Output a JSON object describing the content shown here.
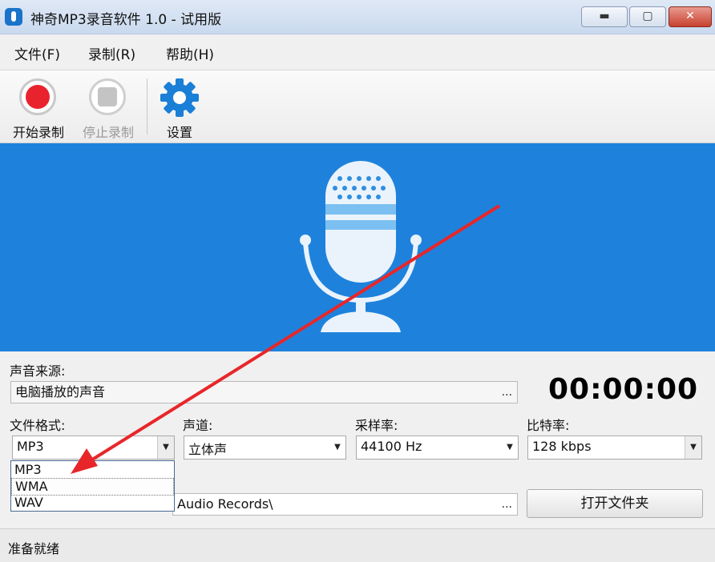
{
  "window": {
    "title": "神奇MP3录音软件 1.0 - 试用版"
  },
  "menu": {
    "items": [
      "文件(F)",
      "录制(R)",
      "帮助(H)"
    ]
  },
  "toolbar": {
    "start_label": "开始录制",
    "stop_label": "停止录制",
    "settings_label": "设置"
  },
  "source": {
    "label": "声音来源:",
    "value": "电脑播放的声音",
    "browse": "..."
  },
  "timer": "00:00:00",
  "format": {
    "label": "文件格式:",
    "value": "MP3",
    "options": [
      "MP3",
      "WMA",
      "WAV"
    ]
  },
  "channel": {
    "label": "声道:",
    "value": "立体声"
  },
  "sample_rate": {
    "label": "采样率:",
    "value": "44100 Hz"
  },
  "bitrate": {
    "label": "比特率:",
    "value": "128 kbps"
  },
  "output": {
    "path": "Audio Records\\",
    "browse": "...",
    "open_folder": "打开文件夹"
  },
  "status": "准备就绪",
  "colors": {
    "accent": "#1e82dc",
    "record": "#e8232d",
    "annotation_arrow": "#e8262a"
  }
}
